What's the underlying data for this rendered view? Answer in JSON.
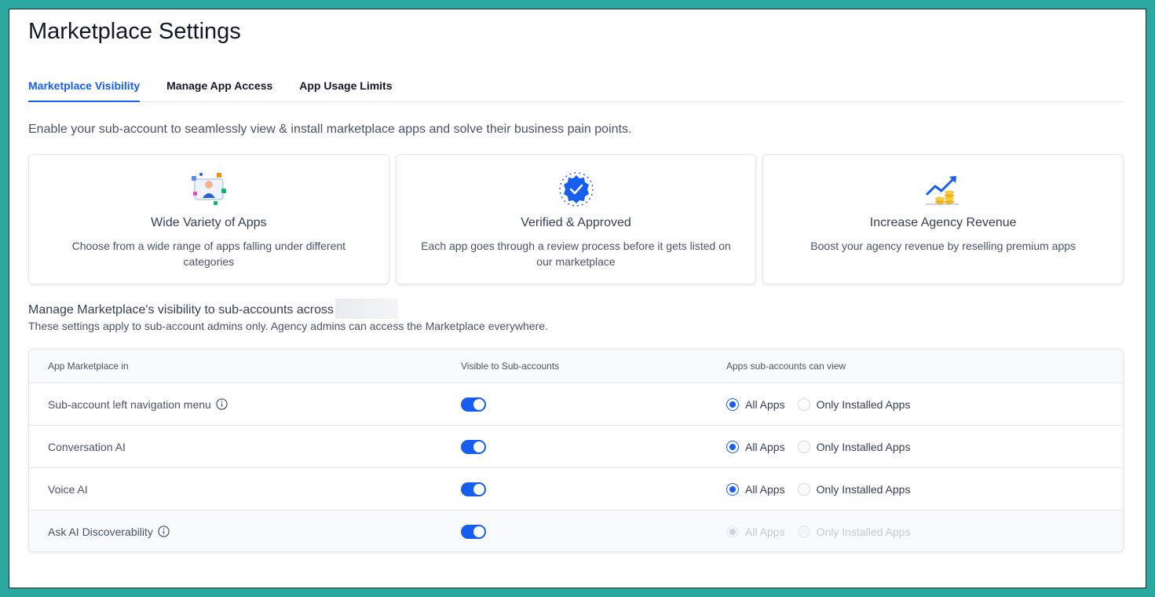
{
  "page": {
    "title": "Marketplace Settings"
  },
  "tabs": [
    {
      "label": "Marketplace Visibility",
      "active": true
    },
    {
      "label": "Manage App Access",
      "active": false
    },
    {
      "label": "App Usage Limits",
      "active": false
    }
  ],
  "intro": "Enable your sub-account to seamlessly view & install marketplace apps and solve their business pain points.",
  "cards": [
    {
      "icon": "apps-illustration-icon",
      "title": "Wide Variety of Apps",
      "desc": "Choose from a wide range of apps falling under different categories"
    },
    {
      "icon": "verified-badge-icon",
      "title": "Verified & Approved",
      "desc": "Each app goes through a review process before it gets listed on our marketplace"
    },
    {
      "icon": "revenue-chart-icon",
      "title": "Increase Agency Revenue",
      "desc": "Boost your agency revenue by reselling premium apps"
    }
  ],
  "section": {
    "title": "Manage Marketplace's visibility to sub-accounts across",
    "subtitle": "These settings apply to sub-account admins only. Agency admins can access the Marketplace everywhere."
  },
  "table": {
    "headers": [
      "App Marketplace in",
      "Visible to Sub-accounts",
      "Apps sub-accounts can view"
    ],
    "options": [
      "All Apps",
      "Only Installed Apps"
    ],
    "rows": [
      {
        "label": "Sub-account left navigation menu",
        "info": true,
        "visible": true,
        "selected": "All Apps",
        "disabled": false
      },
      {
        "label": "Conversation AI",
        "info": false,
        "visible": true,
        "selected": "All Apps",
        "disabled": false
      },
      {
        "label": "Voice AI",
        "info": false,
        "visible": true,
        "selected": "All Apps",
        "disabled": false
      },
      {
        "label": "Ask AI Discoverability",
        "info": true,
        "visible": true,
        "selected": "All Apps",
        "disabled": true
      }
    ]
  },
  "colors": {
    "accent": "#155eef",
    "background": "#2aa8a0"
  }
}
